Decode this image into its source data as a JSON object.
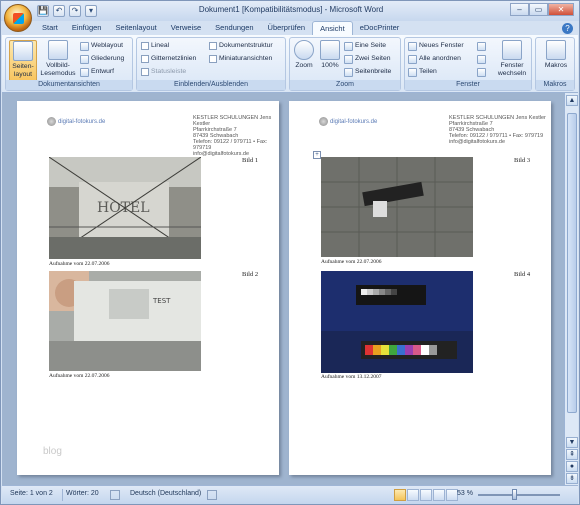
{
  "window": {
    "title": "Dokument1 [Kompatibilitätsmodus] - Microsoft Word"
  },
  "quick_access": {
    "save": "💾",
    "undo": "↶",
    "redo": "↷",
    "more": "▾"
  },
  "window_buttons": {
    "minimize": "–",
    "maximize": "▭",
    "close": "✕"
  },
  "tabs": [
    "Start",
    "Einfügen",
    "Seitenlayout",
    "Verweise",
    "Sendungen",
    "Überprüfen",
    "Ansicht",
    "eDocPrinter"
  ],
  "active_tab": "Ansicht",
  "ribbon": {
    "dokumentansichten": {
      "label": "Dokumentansichten",
      "seitenlayout": "Seiten-\nlayout",
      "seitenlayout_a": "Seiten-",
      "seitenlayout_b": "layout",
      "vollbild_a": "Vollbild-",
      "vollbild_b": "Lesemodus",
      "weblayout": "Weblayout",
      "gliederung": "Gliederung",
      "entwurf": "Entwurf"
    },
    "einblenden": {
      "label": "Einblenden/Ausblenden",
      "lineal": "Lineal",
      "gitternetzlinien": "Gitternetzlinien",
      "statusleiste": "Statusleiste",
      "dokumentstruktur": "Dokumentstruktur",
      "miniaturansichten": "Miniaturansichten"
    },
    "zoom": {
      "label": "Zoom",
      "zoom": "Zoom",
      "hundert": "100%",
      "eine_seite": "Eine Seite",
      "zwei_seiten": "Zwei Seiten",
      "seitenbreite": "Seitenbreite"
    },
    "fenster": {
      "label": "Fenster",
      "neues_fenster": "Neues Fenster",
      "alle_anordnen": "Alle anordnen",
      "teilen": "Teilen",
      "fenster_wechseln_a": "Fenster",
      "fenster_wechseln_b": "wechseln"
    },
    "makros": {
      "label": "Makros",
      "makros": "Makros"
    }
  },
  "header": {
    "line1": "KESTLER SCHULUNGEN Jens Kestler",
    "line2": "Pfarrkirchstraße 7",
    "line3": "87439 Schwabach",
    "line4": "Telefon: 09122 / 979711 • Fax: 979719",
    "line5": "info@digitalfotokurs.de",
    "logo": "digital-fotokurs.de"
  },
  "pages": [
    {
      "bilder": [
        {
          "label": "Bild 1",
          "caption": "Aufnahme vom 22.07.2006"
        },
        {
          "label": "Bild 2",
          "caption": "Aufnahme vom 22.07.2006"
        }
      ]
    },
    {
      "bilder": [
        {
          "label": "Bild 3",
          "caption": "Aufnahme vom 22.07.2006"
        },
        {
          "label": "Bild 4",
          "caption": "Aufnahme vom 13.12.2007"
        }
      ]
    }
  ],
  "watermark": "blog",
  "status": {
    "seite": "Seite: 1 von 2",
    "woerter": "Wörter: 20",
    "sprache": "Deutsch (Deutschland)",
    "zoom": "53 %"
  }
}
